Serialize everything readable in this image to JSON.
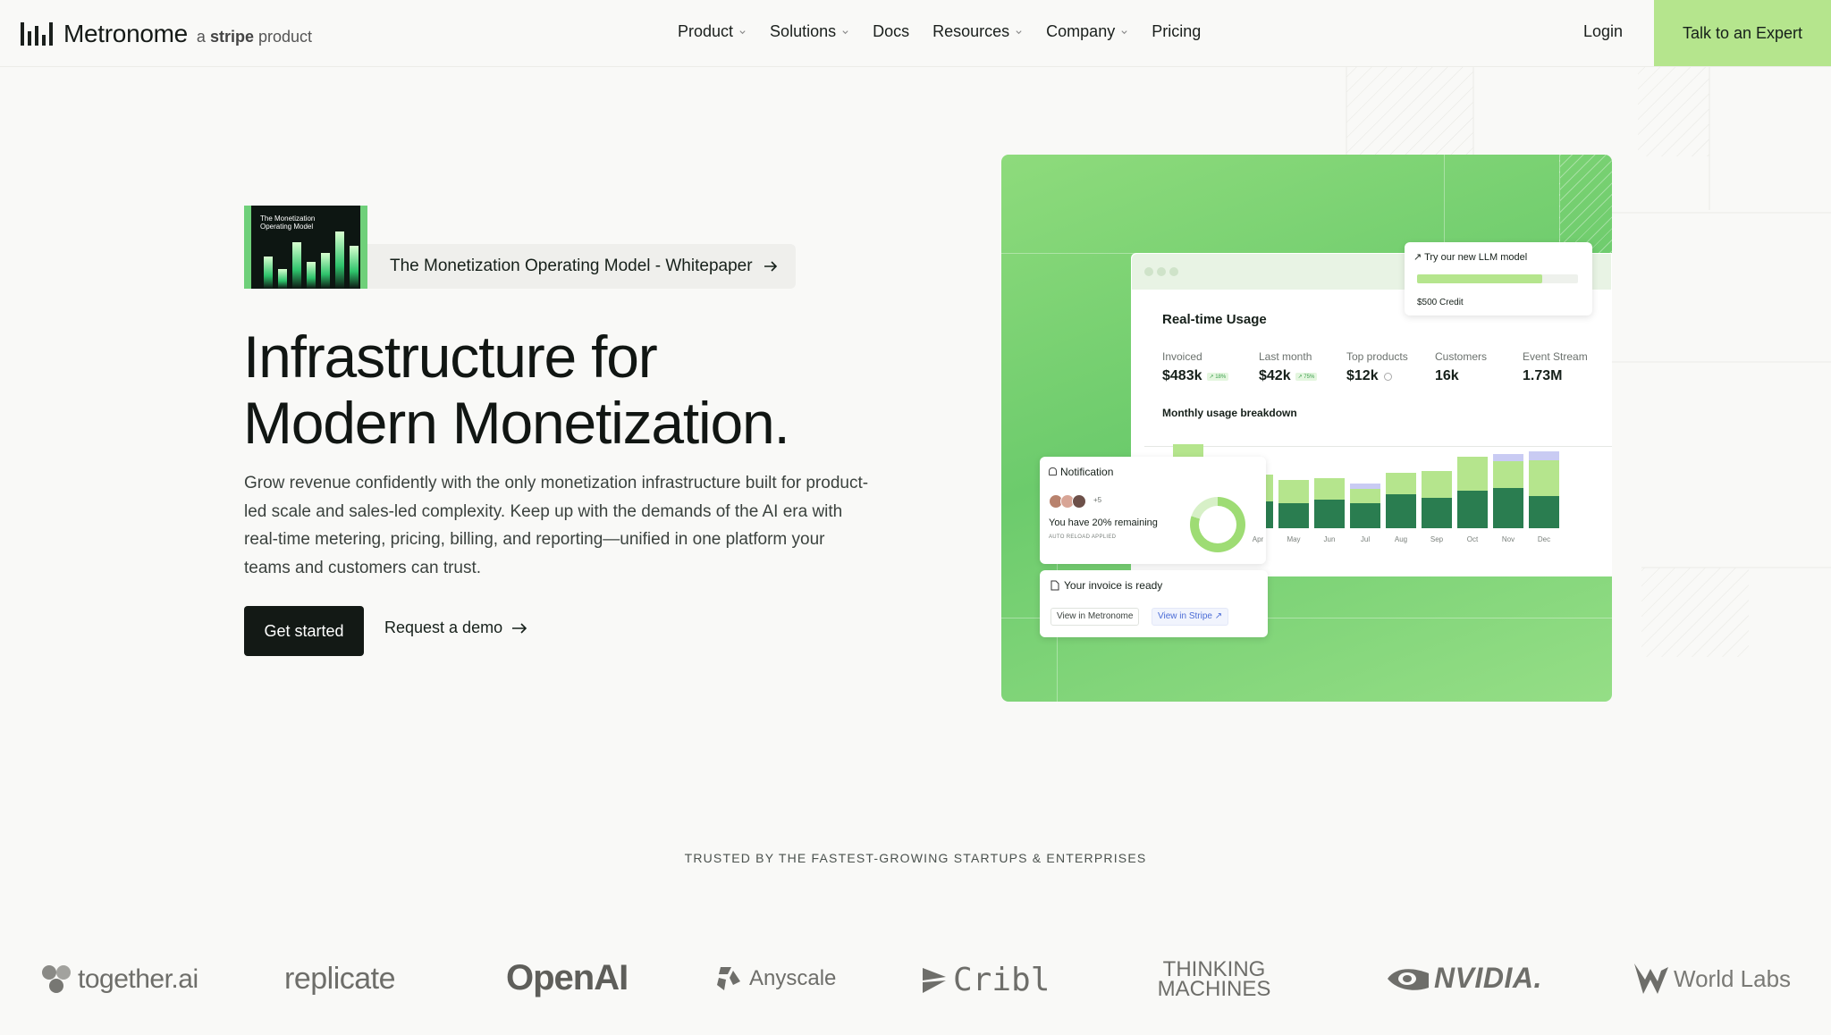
{
  "nav": {
    "brand": "Metronome",
    "sub_prefix": "a",
    "sub_stripe": "stripe",
    "sub_suffix": "product",
    "links": [
      {
        "label": "Product",
        "dropdown": true
      },
      {
        "label": "Solutions",
        "dropdown": true
      },
      {
        "label": "Docs",
        "dropdown": false
      },
      {
        "label": "Resources",
        "dropdown": true
      },
      {
        "label": "Company",
        "dropdown": true
      },
      {
        "label": "Pricing",
        "dropdown": false
      }
    ],
    "login": "Login",
    "cta": "Talk to an Expert"
  },
  "hero": {
    "whitepaper_thumb_title": "The Monetization Operating Model",
    "whitepaper_label": "The Monetization Operating Model - Whitepaper",
    "title_line1": "Infrastructure for",
    "title_line2": "Modern Monetization.",
    "description": "Grow revenue confidently with the only monetization infrastructure built for product-led scale and sales-led complexity. Keep up with the demands of the AI era with real-time metering, pricing, billing, and reporting—unified in one platform your teams and customers can trust.",
    "primary_button": "Get started",
    "secondary_button": "Request a demo"
  },
  "dashboard": {
    "title": "Real-time Usage",
    "stats": [
      {
        "label": "Invoiced",
        "value": "$483k",
        "change": "↗ 18%"
      },
      {
        "label": "Last month",
        "value": "$42k",
        "change": "↗ 75%"
      },
      {
        "label": "Top products",
        "value": "$12k",
        "change": ""
      },
      {
        "label": "Customers",
        "value": "16k",
        "change": ""
      },
      {
        "label": "Event Stream",
        "value": "1.73M",
        "change": ""
      }
    ],
    "chart_title": "Monthly usage breakdown",
    "months": [
      "Apr",
      "May",
      "Jun",
      "Jul",
      "Aug",
      "Sep",
      "Oct",
      "Nov",
      "Dec"
    ],
    "credit_card": {
      "title": "Try our new LLM model",
      "credit": "$500 Credit",
      "progress": 0.78
    },
    "notification": {
      "title": "Notification",
      "extra_count": "+5",
      "message": "You have 20% remaining",
      "sub": "AUTO RELOAD APPLIED",
      "remaining": 0.2
    },
    "invoice": {
      "title": "Your invoice is ready",
      "btn_metronome": "View in Metronome",
      "btn_stripe": "View in Stripe"
    }
  },
  "trusted": {
    "heading": "TRUSTED BY THE FASTEST-GROWING STARTUPS & ENTERPRISES",
    "logos": [
      "together.ai",
      "replicate",
      "OpenAI",
      "Anyscale",
      "Cribl",
      "THINKING MACHINES",
      "NVIDIA.",
      "World Labs"
    ]
  },
  "colors": {
    "accent_green": "#b5e58d",
    "dark": "#131915",
    "bar_dark": "#2a7d50",
    "bar_light": "#b5e58d",
    "bar_lavender": "#c9cbf3"
  }
}
